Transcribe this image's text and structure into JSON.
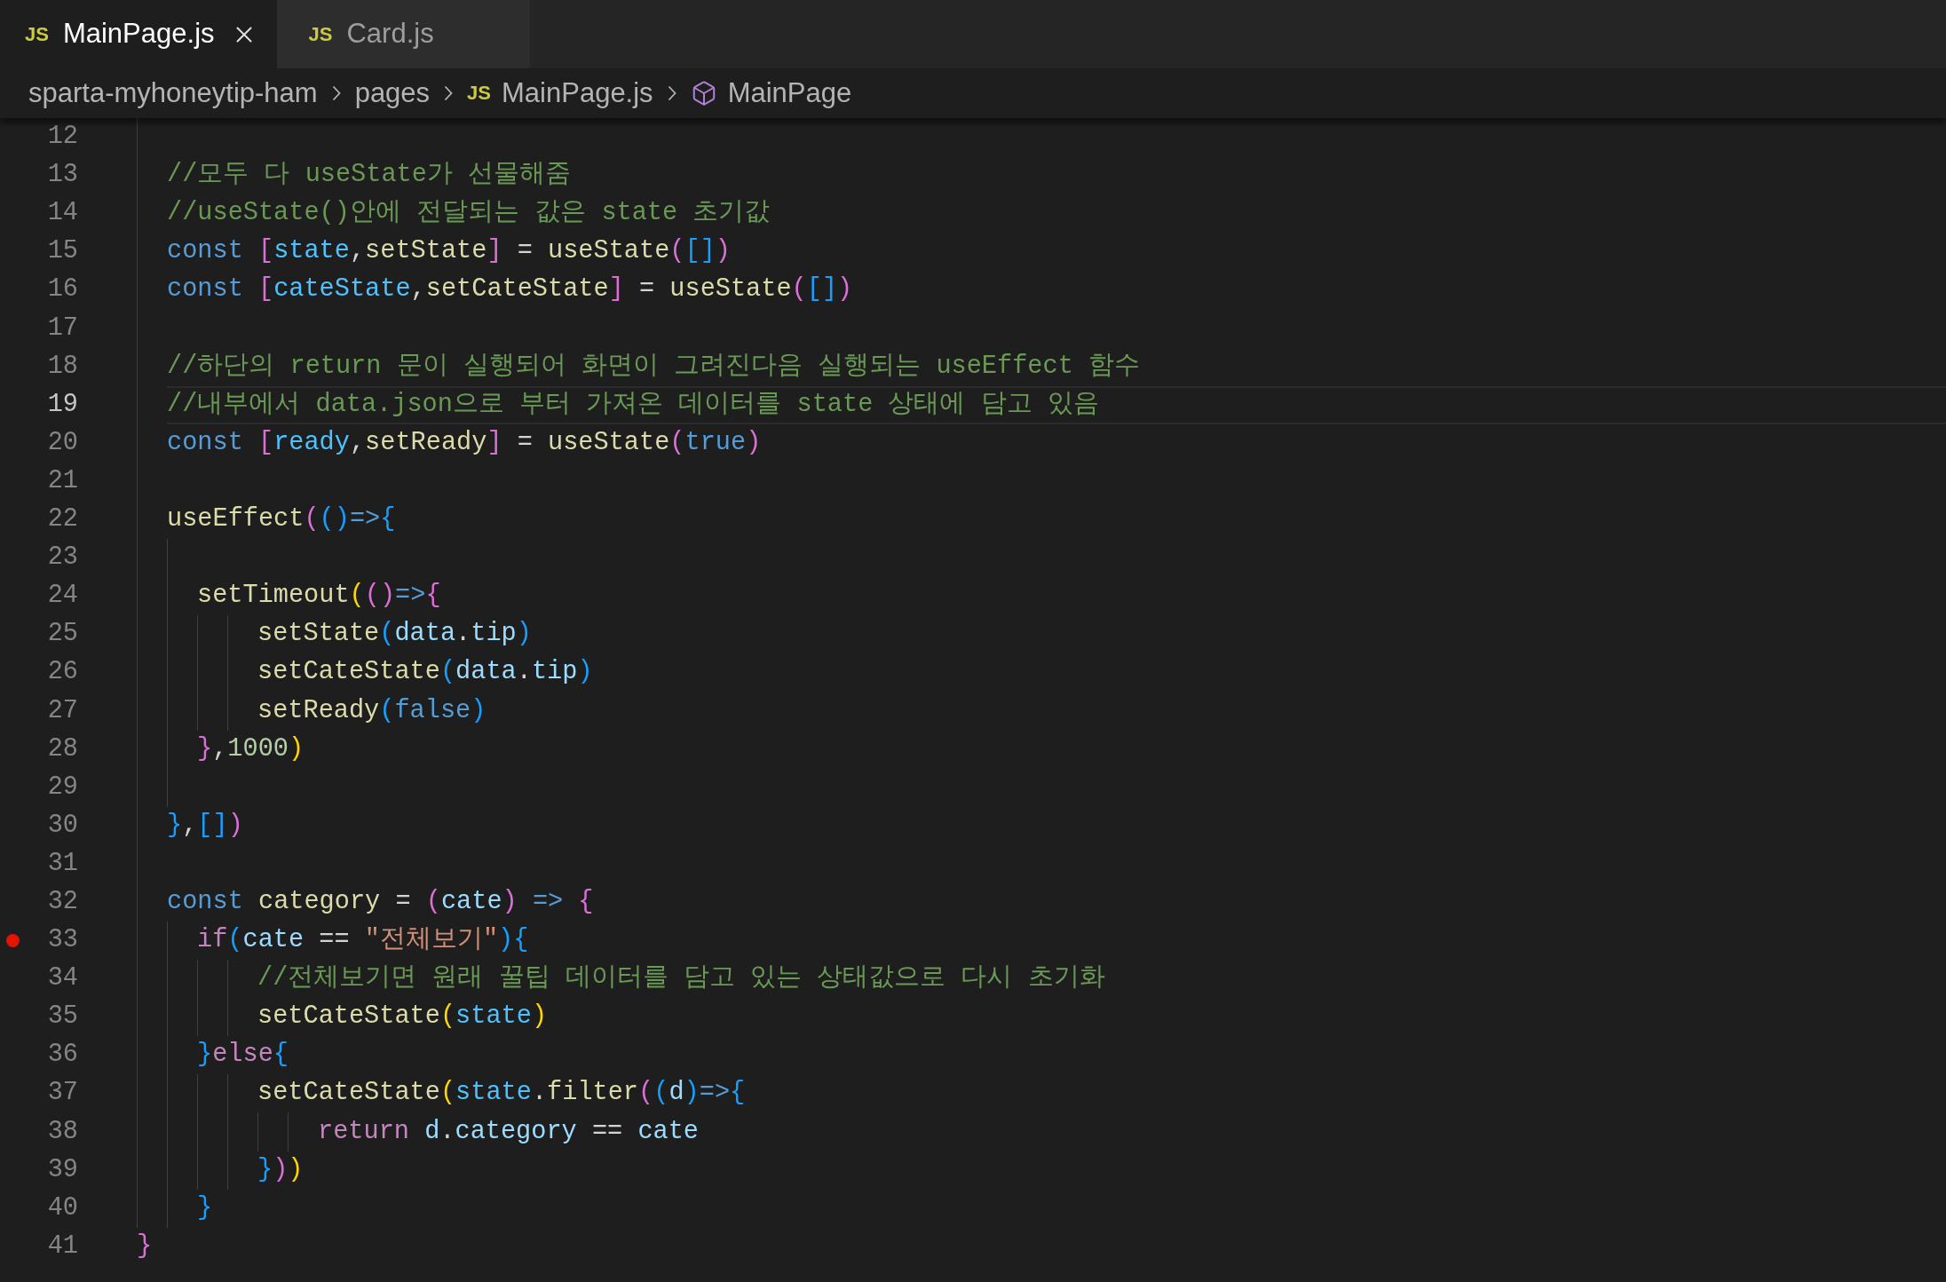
{
  "tabs": [
    {
      "icon": "JS",
      "label": "MainPage.js",
      "selected": true
    },
    {
      "icon": "JS",
      "label": "Card.js",
      "selected": false
    }
  ],
  "breadcrumb": [
    {
      "kind": "folder",
      "label": "sparta-myhoneytip-ham"
    },
    {
      "kind": "folder",
      "label": "pages"
    },
    {
      "kind": "file",
      "icon": "JS",
      "label": "MainPage.js"
    },
    {
      "kind": "symbol",
      "label": "MainPage"
    }
  ],
  "editor": {
    "lines": [
      {
        "kind": "block",
        "children": [
          {
            "kind": "line",
            "number": "12",
            "current": false,
            "breakpoint": false
          },
          {
            "kind": "line",
            "number": "13",
            "current": false,
            "breakpoint": false,
            "tokens": [
              {
                "kind": "comment",
                "text": "//모두 다 useState가 선물해줌"
              }
            ]
          },
          {
            "kind": "line",
            "number": "14",
            "current": false,
            "breakpoint": false,
            "tokens": [
              {
                "kind": "comment",
                "text": "//useState()안에 전달되는 값은 state 초기값"
              }
            ]
          },
          {
            "kind": "line",
            "number": "15",
            "current": false,
            "breakpoint": false,
            "tokens": [
              {
                "kind": "keyword",
                "text": "const "
              },
              {
                "kind": "bracket2",
                "text": "["
              },
              {
                "kind": "constant",
                "text": "state"
              },
              {
                "kind": "plain",
                "text": ","
              },
              {
                "kind": "function",
                "text": "setState"
              },
              {
                "kind": "bracket2",
                "text": "]"
              },
              {
                "kind": "plain",
                "text": " = "
              },
              {
                "kind": "function",
                "text": "useState"
              },
              {
                "kind": "bracket2",
                "text": "("
              },
              {
                "kind": "bracket3",
                "text": "[]"
              },
              {
                "kind": "bracket2",
                "text": ")"
              }
            ]
          },
          {
            "kind": "line",
            "number": "16",
            "current": false,
            "breakpoint": false,
            "tokens": [
              {
                "kind": "keyword",
                "text": "const "
              },
              {
                "kind": "bracket2",
                "text": "["
              },
              {
                "kind": "constant",
                "text": "cateState"
              },
              {
                "kind": "plain",
                "text": ","
              },
              {
                "kind": "function",
                "text": "setCateState"
              },
              {
                "kind": "bracket2",
                "text": "]"
              },
              {
                "kind": "plain",
                "text": " = "
              },
              {
                "kind": "function",
                "text": "useState"
              },
              {
                "kind": "bracket2",
                "text": "("
              },
              {
                "kind": "bracket3",
                "text": "[]"
              },
              {
                "kind": "bracket2",
                "text": ")"
              }
            ]
          },
          {
            "kind": "line",
            "number": "17",
            "current": false,
            "breakpoint": false
          },
          {
            "kind": "line",
            "number": "18",
            "current": false,
            "breakpoint": false,
            "tokens": [
              {
                "kind": "comment",
                "text": "//하단의 return 문이 실행되어 화면이 그려진다음 실행되는 useEffect 함수"
              }
            ]
          },
          {
            "kind": "line",
            "number": "19",
            "current": true,
            "breakpoint": false,
            "tokens": [
              {
                "kind": "comment",
                "text": "//내부에서 data.json으로 부터 가져온 데이터를 state 상태에 담고 있음"
              }
            ]
          },
          {
            "kind": "line",
            "number": "20",
            "current": false,
            "breakpoint": false,
            "tokens": [
              {
                "kind": "keyword",
                "text": "const "
              },
              {
                "kind": "bracket2",
                "text": "["
              },
              {
                "kind": "constant",
                "text": "ready"
              },
              {
                "kind": "plain",
                "text": ","
              },
              {
                "kind": "function",
                "text": "setReady"
              },
              {
                "kind": "bracket2",
                "text": "]"
              },
              {
                "kind": "plain",
                "text": " = "
              },
              {
                "kind": "function",
                "text": "useState"
              },
              {
                "kind": "bracket2",
                "text": "("
              },
              {
                "kind": "keyword",
                "text": "true"
              },
              {
                "kind": "bracket2",
                "text": ")"
              }
            ]
          },
          {
            "kind": "line",
            "number": "21",
            "current": false,
            "breakpoint": false
          },
          {
            "kind": "line",
            "number": "22",
            "current": false,
            "breakpoint": false,
            "tokens": [
              {
                "kind": "function",
                "text": "useEffect"
              },
              {
                "kind": "bracket2",
                "text": "("
              },
              {
                "kind": "bracket3",
                "text": "()"
              },
              {
                "kind": "keyword",
                "text": "=>"
              },
              {
                "kind": "bracket3",
                "text": "{"
              }
            ]
          },
          {
            "kind": "block",
            "children": [
              {
                "kind": "line",
                "number": "23",
                "current": false,
                "breakpoint": false
              },
              {
                "kind": "line",
                "number": "24",
                "current": false,
                "breakpoint": false,
                "tokens": [
                  {
                    "kind": "function",
                    "text": "setTimeout"
                  },
                  {
                    "kind": "bracket1",
                    "text": "("
                  },
                  {
                    "kind": "bracket2",
                    "text": "()"
                  },
                  {
                    "kind": "keyword",
                    "text": "=>"
                  },
                  {
                    "kind": "bracket2",
                    "text": "{"
                  }
                ]
              },
              {
                "kind": "block",
                "children": [
                  {
                    "kind": "block",
                    "children": [
                      {
                        "kind": "line",
                        "number": "25",
                        "current": false,
                        "breakpoint": false,
                        "tokens": [
                          {
                            "kind": "function",
                            "text": "setState"
                          },
                          {
                            "kind": "bracket3",
                            "text": "("
                          },
                          {
                            "kind": "variable",
                            "text": "data"
                          },
                          {
                            "kind": "plain",
                            "text": "."
                          },
                          {
                            "kind": "variable",
                            "text": "tip"
                          },
                          {
                            "kind": "bracket3",
                            "text": ")"
                          }
                        ]
                      },
                      {
                        "kind": "line",
                        "number": "26",
                        "current": false,
                        "breakpoint": false,
                        "tokens": [
                          {
                            "kind": "function",
                            "text": "setCateState"
                          },
                          {
                            "kind": "bracket3",
                            "text": "("
                          },
                          {
                            "kind": "variable",
                            "text": "data"
                          },
                          {
                            "kind": "plain",
                            "text": "."
                          },
                          {
                            "kind": "variable",
                            "text": "tip"
                          },
                          {
                            "kind": "bracket3",
                            "text": ")"
                          }
                        ]
                      },
                      {
                        "kind": "line",
                        "number": "27",
                        "current": false,
                        "breakpoint": false,
                        "tokens": [
                          {
                            "kind": "function",
                            "text": "setReady"
                          },
                          {
                            "kind": "bracket3",
                            "text": "("
                          },
                          {
                            "kind": "keyword",
                            "text": "false"
                          },
                          {
                            "kind": "bracket3",
                            "text": ")"
                          }
                        ]
                      }
                    ]
                  }
                ]
              },
              {
                "kind": "line",
                "number": "28",
                "current": false,
                "breakpoint": false,
                "tokens": [
                  {
                    "kind": "bracket2",
                    "text": "}"
                  },
                  {
                    "kind": "plain",
                    "text": ","
                  },
                  {
                    "kind": "number",
                    "text": "1000"
                  },
                  {
                    "kind": "bracket1",
                    "text": ")"
                  }
                ]
              },
              {
                "kind": "line",
                "number": "29",
                "current": false,
                "breakpoint": false
              }
            ]
          },
          {
            "kind": "line",
            "number": "30",
            "current": false,
            "breakpoint": false,
            "tokens": [
              {
                "kind": "bracket3",
                "text": "}"
              },
              {
                "kind": "plain",
                "text": ","
              },
              {
                "kind": "bracket3",
                "text": "[]"
              },
              {
                "kind": "bracket2",
                "text": ")"
              }
            ]
          },
          {
            "kind": "line",
            "number": "31",
            "current": false,
            "breakpoint": false
          },
          {
            "kind": "line",
            "number": "32",
            "current": false,
            "breakpoint": false,
            "tokens": [
              {
                "kind": "keyword",
                "text": "const "
              },
              {
                "kind": "function",
                "text": "category"
              },
              {
                "kind": "plain",
                "text": " = "
              },
              {
                "kind": "bracket2",
                "text": "("
              },
              {
                "kind": "variable",
                "text": "cate"
              },
              {
                "kind": "bracket2",
                "text": ")"
              },
              {
                "kind": "keyword",
                "text": " => "
              },
              {
                "kind": "bracket2",
                "text": "{"
              }
            ]
          },
          {
            "kind": "block",
            "children": [
              {
                "kind": "line",
                "number": "33",
                "current": false,
                "breakpoint": true,
                "tokens": [
                  {
                    "kind": "control",
                    "text": "if"
                  },
                  {
                    "kind": "bracket3",
                    "text": "("
                  },
                  {
                    "kind": "variable",
                    "text": "cate"
                  },
                  {
                    "kind": "plain",
                    "text": " == "
                  },
                  {
                    "kind": "string",
                    "text": "\"전체보기\""
                  },
                  {
                    "kind": "bracket3",
                    "text": ")"
                  },
                  {
                    "kind": "bracket3",
                    "text": "{"
                  }
                ]
              },
              {
                "kind": "block",
                "children": [
                  {
                    "kind": "block",
                    "children": [
                      {
                        "kind": "line",
                        "number": "34",
                        "current": false,
                        "breakpoint": false,
                        "tokens": [
                          {
                            "kind": "comment",
                            "text": "//전체보기면 원래 꿀팁 데이터를 담고 있는 상태값으로 다시 초기화"
                          }
                        ]
                      },
                      {
                        "kind": "line",
                        "number": "35",
                        "current": false,
                        "breakpoint": false,
                        "tokens": [
                          {
                            "kind": "function",
                            "text": "setCateState"
                          },
                          {
                            "kind": "bracket1",
                            "text": "("
                          },
                          {
                            "kind": "constant",
                            "text": "state"
                          },
                          {
                            "kind": "bracket1",
                            "text": ")"
                          }
                        ]
                      }
                    ]
                  }
                ]
              },
              {
                "kind": "line",
                "number": "36",
                "current": false,
                "breakpoint": false,
                "tokens": [
                  {
                    "kind": "bracket3",
                    "text": "}"
                  },
                  {
                    "kind": "control",
                    "text": "else"
                  },
                  {
                    "kind": "bracket3",
                    "text": "{"
                  }
                ]
              },
              {
                "kind": "block",
                "children": [
                  {
                    "kind": "block",
                    "children": [
                      {
                        "kind": "line",
                        "number": "37",
                        "current": false,
                        "breakpoint": false,
                        "tokens": [
                          {
                            "kind": "function",
                            "text": "setCateState"
                          },
                          {
                            "kind": "bracket1",
                            "text": "("
                          },
                          {
                            "kind": "constant",
                            "text": "state"
                          },
                          {
                            "kind": "plain",
                            "text": "."
                          },
                          {
                            "kind": "function",
                            "text": "filter"
                          },
                          {
                            "kind": "bracket2",
                            "text": "("
                          },
                          {
                            "kind": "bracket3",
                            "text": "("
                          },
                          {
                            "kind": "variable",
                            "text": "d"
                          },
                          {
                            "kind": "bracket3",
                            "text": ")"
                          },
                          {
                            "kind": "keyword",
                            "text": "=>"
                          },
                          {
                            "kind": "bracket3",
                            "text": "{"
                          }
                        ]
                      },
                      {
                        "kind": "block",
                        "children": [
                          {
                            "kind": "block",
                            "children": [
                              {
                                "kind": "line",
                                "number": "38",
                                "current": false,
                                "breakpoint": false,
                                "tokens": [
                                  {
                                    "kind": "control",
                                    "text": "return "
                                  },
                                  {
                                    "kind": "variable",
                                    "text": "d"
                                  },
                                  {
                                    "kind": "plain",
                                    "text": "."
                                  },
                                  {
                                    "kind": "variable",
                                    "text": "category"
                                  },
                                  {
                                    "kind": "plain",
                                    "text": " == "
                                  },
                                  {
                                    "kind": "variable",
                                    "text": "cate"
                                  }
                                ]
                              }
                            ]
                          }
                        ]
                      },
                      {
                        "kind": "line",
                        "number": "39",
                        "current": false,
                        "breakpoint": false,
                        "tokens": [
                          {
                            "kind": "bracket3",
                            "text": "}"
                          },
                          {
                            "kind": "bracket2",
                            "text": ")"
                          },
                          {
                            "kind": "bracket1",
                            "text": ")"
                          }
                        ]
                      }
                    ]
                  }
                ]
              },
              {
                "kind": "line",
                "number": "40",
                "current": false,
                "breakpoint": false,
                "tokens": [
                  {
                    "kind": "bracket3",
                    "text": "}"
                  }
                ]
              }
            ]
          }
        ]
      },
      {
        "kind": "line",
        "number": "41",
        "current": false,
        "breakpoint": false,
        "tokens": [
          {
            "kind": "bracket2",
            "text": "}"
          }
        ]
      }
    ]
  }
}
